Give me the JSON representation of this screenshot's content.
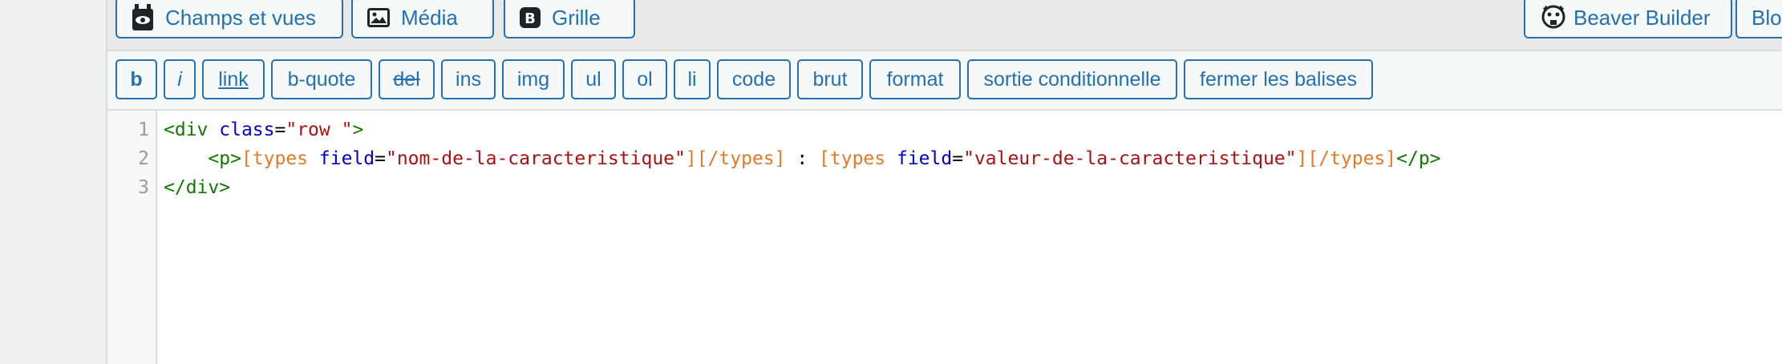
{
  "media_buttons": {
    "fields_views": "Champs et vues",
    "media": "Média",
    "grid": "Grille",
    "beaver_builder": "Beaver Builder",
    "blocks_partial": "Blo"
  },
  "quicktags": [
    "b",
    "i",
    "link",
    "b-quote",
    "del",
    "ins",
    "img",
    "ul",
    "ol",
    "li",
    "code",
    "brut",
    "format",
    "sortie conditionnelle",
    "fermer les balises"
  ],
  "editor": {
    "line_numbers": [
      "1",
      "2",
      "3"
    ],
    "line1": {
      "open": "<div ",
      "attr": "class",
      "eq": "=",
      "val": "\"row \"",
      "close": ">"
    },
    "line2": {
      "indent": "    ",
      "p_open": "<p>",
      "sc1_open": "[types ",
      "attr1": "field",
      "eq1": "=",
      "val1": "\"nom-de-la-caracteristique\"",
      "sc1_mid": "][/types]",
      "sep": " : ",
      "sc2_open": "[types ",
      "attr2": "field",
      "eq2": "=",
      "val2": "\"valeur-de-la-caracteristique\"",
      "sc2_mid": "][/types]",
      "p_close": "</p>"
    },
    "line3": {
      "close": "</div>"
    }
  },
  "colors": {
    "accent": "#2271b1",
    "tag": "#117700",
    "attribute": "#0000cc",
    "string": "#aa1111",
    "shortcode": "#e07a28"
  }
}
